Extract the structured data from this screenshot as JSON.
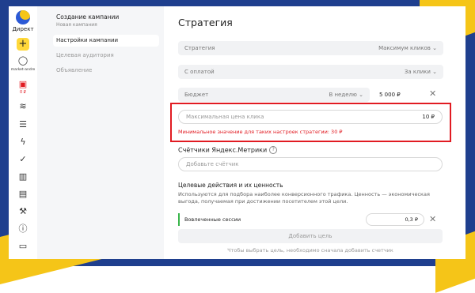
{
  "brand": {
    "name": "Директ"
  },
  "rail": {
    "plus": "+",
    "user_label": "market-andre",
    "balance": "0 ₽"
  },
  "nav": {
    "campaign_title": "Создание кампании",
    "campaign_subtitle": "Новая кампания",
    "items": [
      "Настройки кампании",
      "Целевая аудитория",
      "Объявление"
    ]
  },
  "main": {
    "heading": "Стратегия",
    "strategy": {
      "label": "Стратегия",
      "value": "Максимум кликов"
    },
    "payment": {
      "label": "С оплатой",
      "value": "За клики"
    },
    "budget": {
      "label": "Бюджет",
      "period": "В неделю",
      "amount": "5 000 ₽"
    },
    "max_cpc": {
      "placeholder": "Максимальная цена клика",
      "value": "10 ₽"
    },
    "error": "Минимальное значение для таких настроек стратегии: 30 ₽",
    "metrika_heading": "Счётчики Яндекс.Метрики",
    "add_counter": "Добавьте счётчик",
    "goals_heading": "Целевые действия и их ценность",
    "goals_desc": "Используются для подбора наиболее конверсионного трафика. Ценность — экономическая выгода, получаемая при достижении посетителем этой цели.",
    "goal_name": "Вовлеченные сессии",
    "goal_value": "0,3 ₽",
    "add_goal": "Добавить цель",
    "hint": "Чтобы выбрать цель, необходимо сначала добавить счетчик"
  }
}
